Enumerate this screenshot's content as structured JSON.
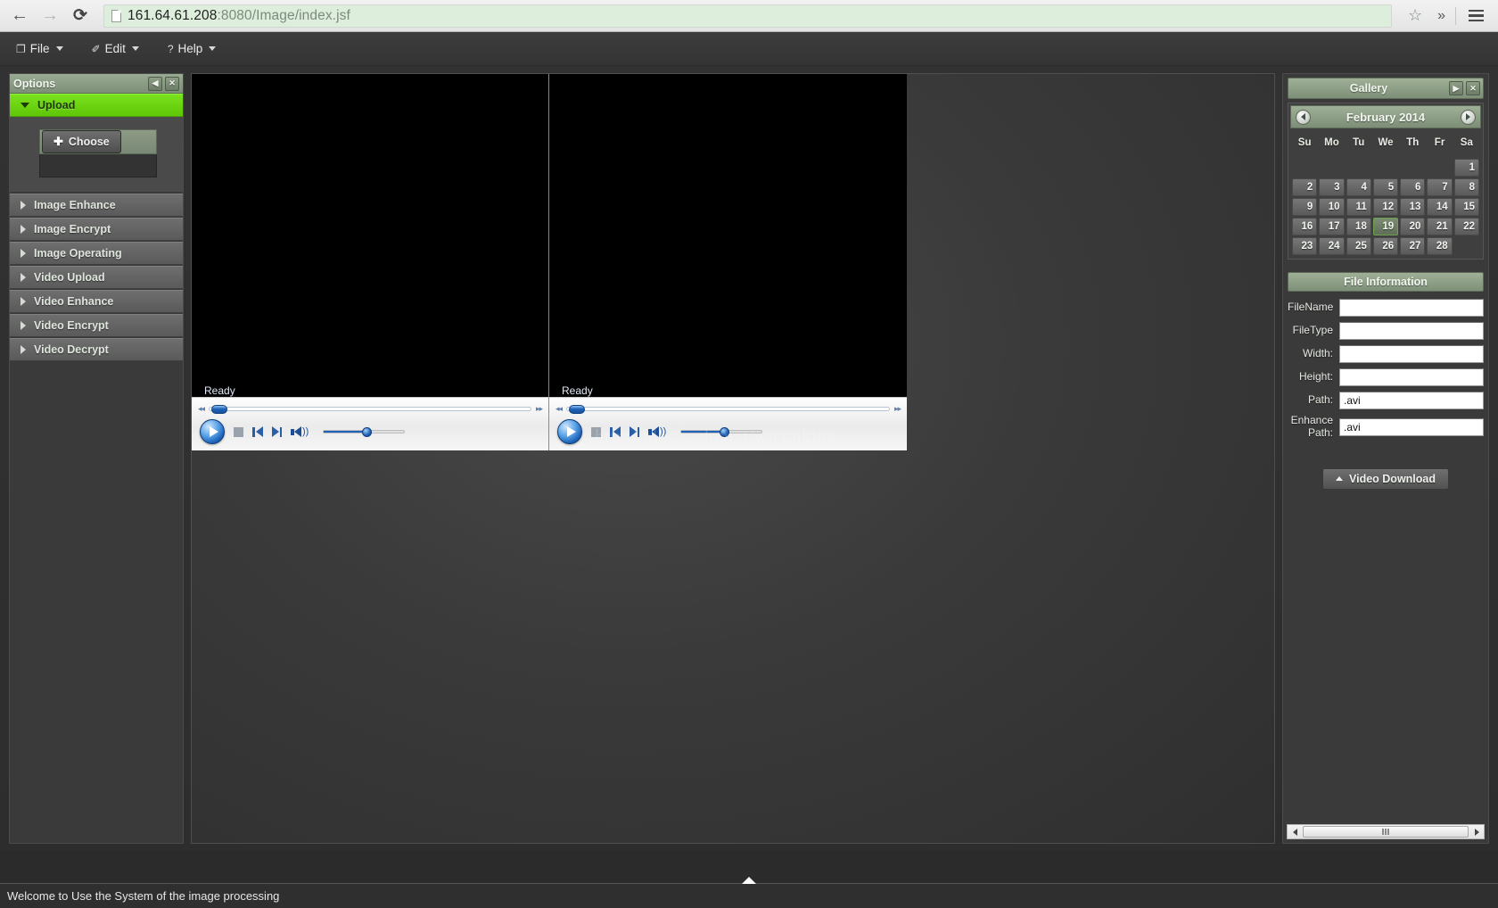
{
  "browser": {
    "back_icon": "arrow-left-icon",
    "forward_icon": "arrow-right-icon",
    "reload_icon": "reload-icon",
    "url_host": "161.64.61.208",
    "url_rest": ":8080/Image/index.jsf",
    "star_glyph": "☆",
    "more_glyph": "»"
  },
  "menubar": {
    "items": [
      {
        "label": "File",
        "glyph": "❐"
      },
      {
        "label": "Edit",
        "glyph": "✐"
      },
      {
        "label": "Help",
        "glyph": "?"
      }
    ]
  },
  "options_panel": {
    "title": "Options",
    "collapse_glyph": "◀",
    "close_glyph": "✕",
    "sections": [
      {
        "label": "Upload",
        "active": true
      },
      {
        "label": "Image Enhance",
        "active": false
      },
      {
        "label": "Image Encrypt",
        "active": false
      },
      {
        "label": "Image Operating",
        "active": false
      },
      {
        "label": "Video Upload",
        "active": false
      },
      {
        "label": "Video Enhance",
        "active": false
      },
      {
        "label": "Video Encrypt",
        "active": false
      },
      {
        "label": "Video Decrypt",
        "active": false
      }
    ],
    "upload": {
      "choose_label": "Choose",
      "choose_plus": "✚",
      "dropzone_value": ""
    }
  },
  "players": [
    {
      "status": "Ready",
      "play_icon": "play-icon",
      "stop_icon": "stop-icon",
      "prev_icon": "skip-previous-icon",
      "next_icon": "skip-next-icon",
      "volume_icon": "speaker-icon",
      "rewind_glyph": "◂◂",
      "forward_glyph": "▸▸"
    },
    {
      "status": "Ready",
      "play_icon": "play-icon",
      "stop_icon": "stop-icon",
      "prev_icon": "skip-previous-icon",
      "next_icon": "skip-next-icon",
      "volume_icon": "speaker-icon",
      "rewind_glyph": "◂◂",
      "forward_glyph": "▸▸"
    }
  ],
  "watermark": "http://blog.csdn.net/wjcquking",
  "gallery": {
    "title": "Gallery",
    "expand_glyph": "▶",
    "close_glyph": "✕",
    "calendar": {
      "month_label": "February 2014",
      "weekdays": [
        "Su",
        "Mo",
        "Tu",
        "We",
        "Th",
        "Fr",
        "Sa"
      ],
      "weeks": [
        [
          "",
          "",
          "",
          "",
          "",
          "",
          "1"
        ],
        [
          "2",
          "3",
          "4",
          "5",
          "6",
          "7",
          "8"
        ],
        [
          "9",
          "10",
          "11",
          "12",
          "13",
          "14",
          "15"
        ],
        [
          "16",
          "17",
          "18",
          "19",
          "20",
          "21",
          "22"
        ],
        [
          "23",
          "24",
          "25",
          "26",
          "27",
          "28",
          ""
        ]
      ],
      "today": "19"
    }
  },
  "file_information": {
    "title": "File Information",
    "fields": [
      {
        "label": "FileName",
        "value": ""
      },
      {
        "label": "FileType",
        "value": ""
      },
      {
        "label": "Width:",
        "value": ""
      },
      {
        "label": "Height:",
        "value": ""
      },
      {
        "label": "Path:",
        "value": ".avi"
      },
      {
        "label": "Enhance Path:",
        "value": ".avi"
      }
    ],
    "download_label": "Video Download",
    "download_caret": "▲"
  },
  "statusbar": {
    "message": "Welcome to Use the System of the image processing"
  },
  "colors": {
    "accent_green": "#6fd40f",
    "panel_header": "#8a9b83",
    "player_blue": "#1e63b8",
    "chrome_bg": "#343434"
  }
}
